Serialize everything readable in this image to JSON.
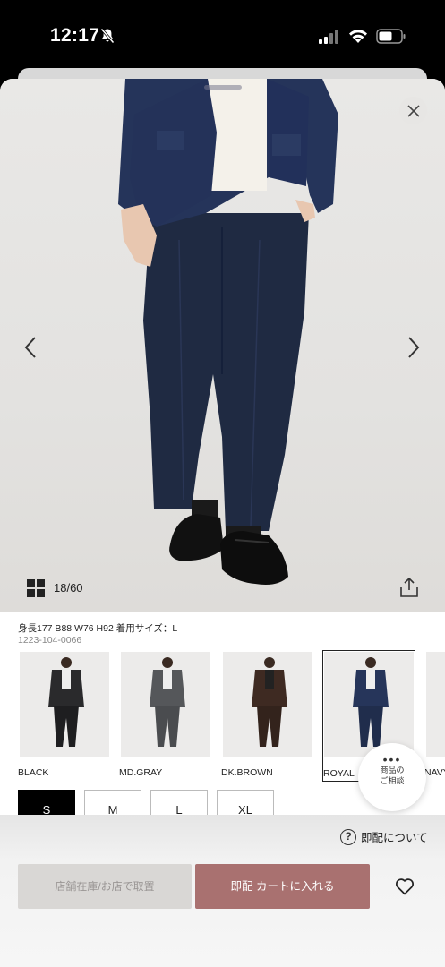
{
  "status_bar": {
    "time": "12:17"
  },
  "gallery": {
    "counter": "18/60"
  },
  "model_info": "身長177 B88 W76 H92 着用サイズ：L",
  "sku": "1223-104-0066",
  "colors": [
    {
      "label": "BLACK",
      "jacket": "#2a2a2c",
      "pants": "#1e1e20"
    },
    {
      "label": "MD.GRAY",
      "jacket": "#55575a",
      "pants": "#4a4c4f"
    },
    {
      "label": "DK.BROWN",
      "jacket": "#3e2a22",
      "pants": "#33231c"
    },
    {
      "label": "ROYAL",
      "jacket": "#26355a",
      "pants": "#202d4c"
    },
    {
      "label": "NAVY",
      "jacket": "#1f2a44",
      "pants": "#1a2338"
    }
  ],
  "selected_color": "ROYAL",
  "sizes": [
    "S",
    "M",
    "L",
    "XL"
  ],
  "selected_size": "S",
  "consult": {
    "dots": "•••",
    "line1": "商品の",
    "line2": "ご相談"
  },
  "shipping_link": "即配について",
  "buttons": {
    "store": "店舗在庫/お店で取置",
    "cart": "即配 カートに入れる"
  },
  "colors_theme": {
    "cart": "#a97170",
    "store": "#d9d7d5"
  }
}
